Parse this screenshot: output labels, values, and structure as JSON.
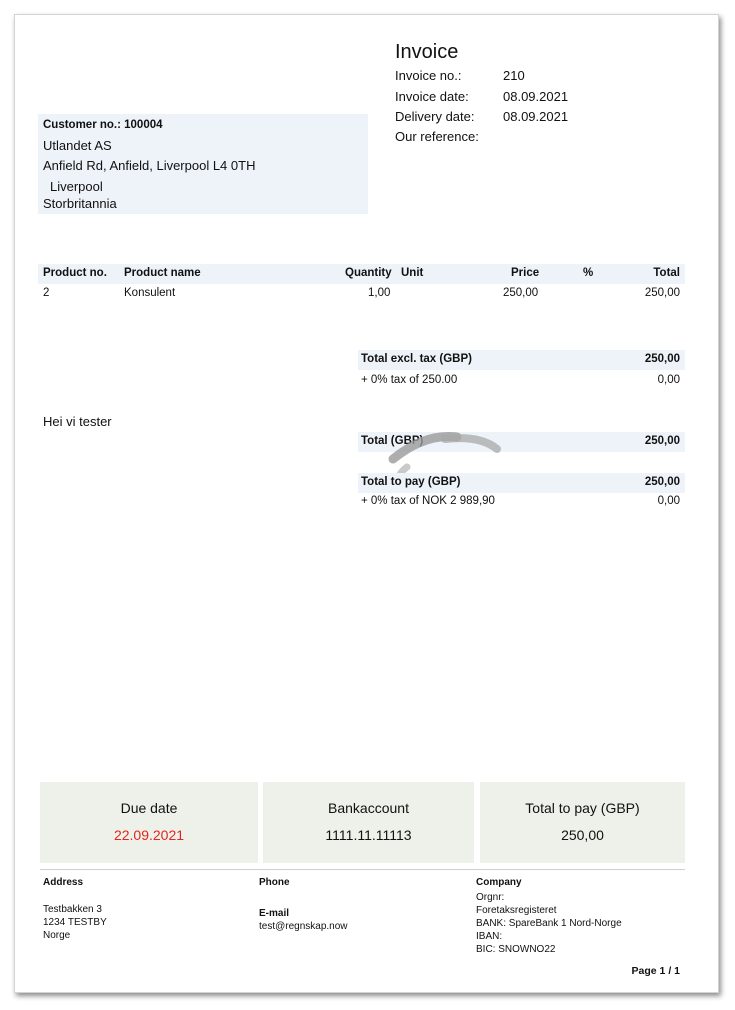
{
  "invoice": {
    "title": "Invoice",
    "invoice_no_label": "Invoice no.:",
    "invoice_no": "210",
    "invoice_date_label": "Invoice date:",
    "invoice_date": "08.09.2021",
    "delivery_date_label": "Delivery date:",
    "delivery_date": "08.09.2021",
    "our_reference_label": "Our reference:"
  },
  "customer": {
    "number_line": "Customer no.: 100004",
    "name": "Utlandet AS",
    "address": "Anfield Rd, Anfield, Liverpool L4 0TH",
    "city": "Liverpool",
    "country": "Storbritannia"
  },
  "table": {
    "headers": {
      "product_no": "Product no.",
      "product_name": "Product name",
      "quantity": "Quantity",
      "unit": "Unit",
      "price": "Price",
      "percent": "%",
      "total": "Total"
    },
    "rows": [
      {
        "product_no": "2",
        "product_name": "Konsulent",
        "quantity": "1,00",
        "unit": "",
        "price": "250,00",
        "percent": "",
        "total": "250,00"
      }
    ]
  },
  "totals": {
    "excl_tax_label": "Total excl. tax (GBP)",
    "excl_tax_value": "250,00",
    "tax_label": "+ 0% tax of 250.00",
    "tax_value": "0,00",
    "total_label": "Total (GBP)",
    "total_value": "250,00",
    "to_pay_label": "Total to pay (GBP)",
    "to_pay_value": "250,00",
    "nok_tax_label": "+ 0% tax of NOK 2 989,90",
    "nok_tax_value": "0,00"
  },
  "note": "Hei vi tester",
  "summary": {
    "due_date_label": "Due date",
    "due_date_value": "22.09.2021",
    "bank_label": "Bankaccount",
    "bank_value": "1111.11.11113",
    "pay_label": "Total to pay (GBP)",
    "pay_value": "250,00",
    "due_color": "#e0261e"
  },
  "footer": {
    "address_heading": "Address",
    "address_lines": [
      "Testbakken 3",
      "1234 TESTBY",
      "Norge"
    ],
    "phone_heading": "Phone",
    "email_heading": "E-mail",
    "email": "test@regnskap.now",
    "company_heading": "Company",
    "company_lines": [
      "Orgnr:",
      "Foretaksregisteret",
      "BANK: SpareBank 1 Nord-Norge",
      "IBAN:",
      "BIC: SNOWNO22"
    ],
    "page": "Page 1 / 1"
  }
}
